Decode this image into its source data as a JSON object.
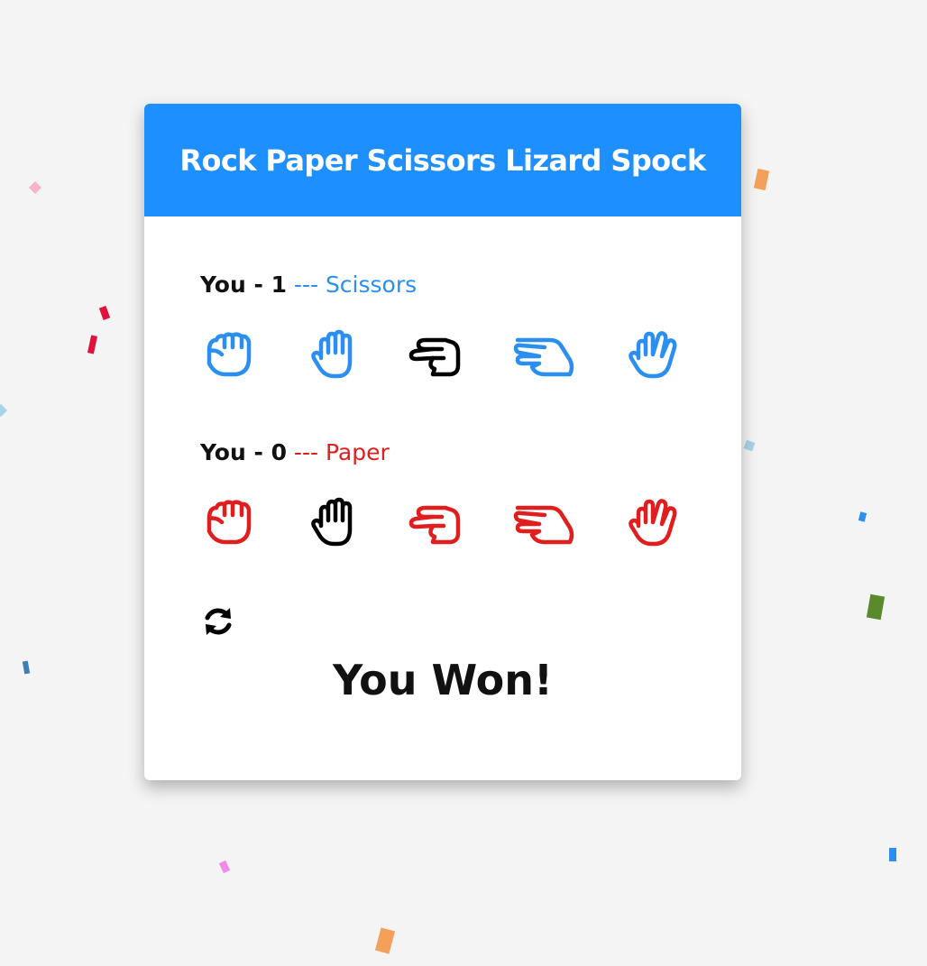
{
  "header": {
    "title": "Rock Paper Scissors Lizard Spock"
  },
  "player1": {
    "prefix": "You - ",
    "score": "1",
    "choice_text": " --- Scissors",
    "accent": "#2a8ff0",
    "selected_index": 2
  },
  "player2": {
    "prefix": "You - ",
    "score": "0",
    "choice_text": " --- Paper",
    "accent": "#e01e1e",
    "selected_index": 1
  },
  "hand_icons": [
    "rock-icon",
    "paper-icon",
    "scissors-icon",
    "lizard-icon",
    "spock-icon"
  ],
  "reset": {
    "icon": "refresh-icon"
  },
  "result": {
    "text": "You Won!"
  },
  "colors": {
    "header": "#1e8fff",
    "background": "#f4f4f4",
    "selected": "#000000"
  }
}
